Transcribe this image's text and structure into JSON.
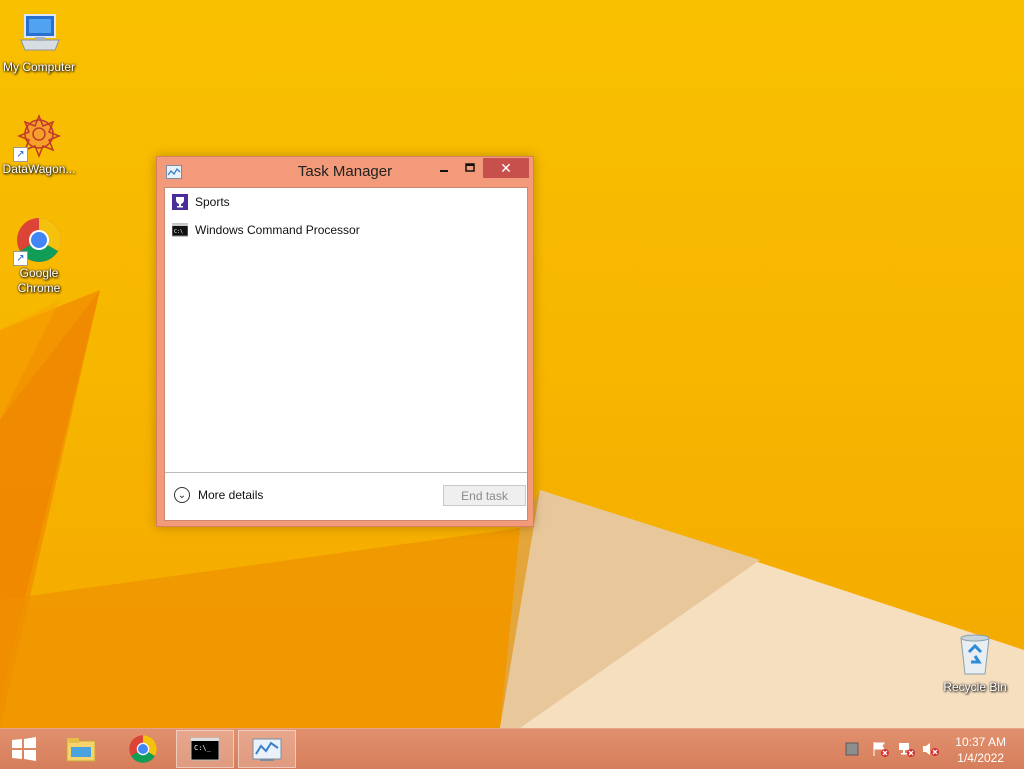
{
  "desktop": {
    "icons": [
      {
        "label": "My Computer",
        "icon": "computer-icon"
      },
      {
        "label": "DataWagon...",
        "icon": "datawagon-icon"
      },
      {
        "label": "Google Chrome",
        "icon": "chrome-icon"
      },
      {
        "label": "Recycle Bin",
        "icon": "recycle-bin-icon"
      }
    ]
  },
  "window": {
    "title": "Task Manager",
    "processes": [
      {
        "name": "Sports",
        "icon": "sports-trophy-icon"
      },
      {
        "name": "Windows Command Processor",
        "icon": "cmd-icon"
      }
    ],
    "more_details": "More details",
    "end_task": "End task"
  },
  "taskbar": {
    "items": [
      "start-icon",
      "file-explorer-icon",
      "chrome-icon",
      "cmd-icon",
      "task-manager-icon"
    ],
    "clock": {
      "time": "10:37 AM",
      "date": "1/4/2022"
    }
  },
  "colors": {
    "desktop": "#f7b600",
    "taskbar": "#d98360",
    "window_frame": "#f29a79",
    "close_button": "#c7504c"
  }
}
